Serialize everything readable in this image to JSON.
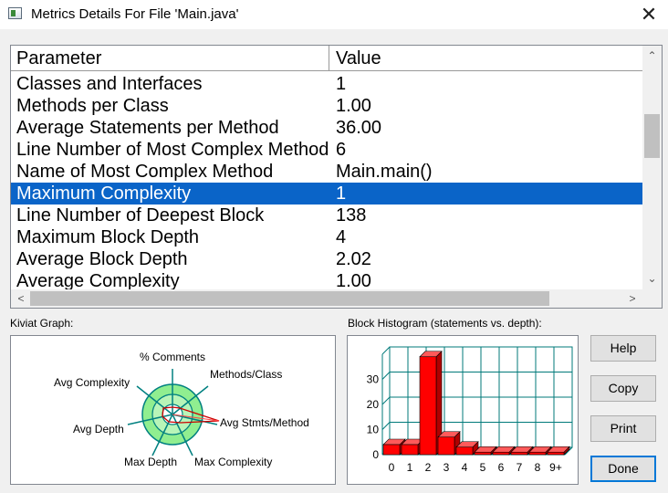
{
  "window": {
    "title": "Metrics Details For File 'Main.java'",
    "close_glyph": "✕"
  },
  "table": {
    "headers": {
      "parameter": "Parameter",
      "value": "Value"
    },
    "rows": [
      {
        "parameter": "Classes and Interfaces",
        "value": "1"
      },
      {
        "parameter": "Methods per Class",
        "value": "1.00"
      },
      {
        "parameter": "Average Statements per Method",
        "value": "36.00"
      },
      {
        "parameter": "Line Number of Most Complex Method",
        "value": "6"
      },
      {
        "parameter": "Name of Most Complex Method",
        "value": "Main.main()"
      },
      {
        "parameter": "Maximum Complexity",
        "value": "1"
      },
      {
        "parameter": "Line Number of Deepest Block",
        "value": "138"
      },
      {
        "parameter": "Maximum Block Depth",
        "value": "4"
      },
      {
        "parameter": "Average Block Depth",
        "value": "2.02"
      },
      {
        "parameter": "Average Complexity",
        "value": "1.00"
      }
    ],
    "selected_row": "Maximum Complexity"
  },
  "kiviat": {
    "label": "Kiviat Graph:",
    "axes": [
      "% Comments",
      "Methods/Class",
      "Avg Stmts/Method",
      "Max Complexity",
      "Max Depth",
      "Avg Depth",
      "Avg Complexity"
    ]
  },
  "histogram": {
    "label": "Block Histogram (statements vs. depth):",
    "bar_color": "#ff0000",
    "grid_color": "#007a7a"
  },
  "chart_data": {
    "type": "bar",
    "title": "Block Histogram (statements vs. depth):",
    "categories": [
      "0",
      "1",
      "2",
      "3",
      "4",
      "5",
      "6",
      "7",
      "8",
      "9+"
    ],
    "values": [
      4,
      4,
      39,
      7,
      3,
      1,
      1,
      1,
      1,
      1
    ],
    "yticks": [
      "0",
      "10",
      "20",
      "30"
    ],
    "ylim": [
      0,
      40
    ],
    "grid": true
  },
  "buttons": {
    "help": "Help",
    "copy": "Copy",
    "print": "Print",
    "done": "Done"
  },
  "colors": {
    "selection": "#0a64c8"
  }
}
